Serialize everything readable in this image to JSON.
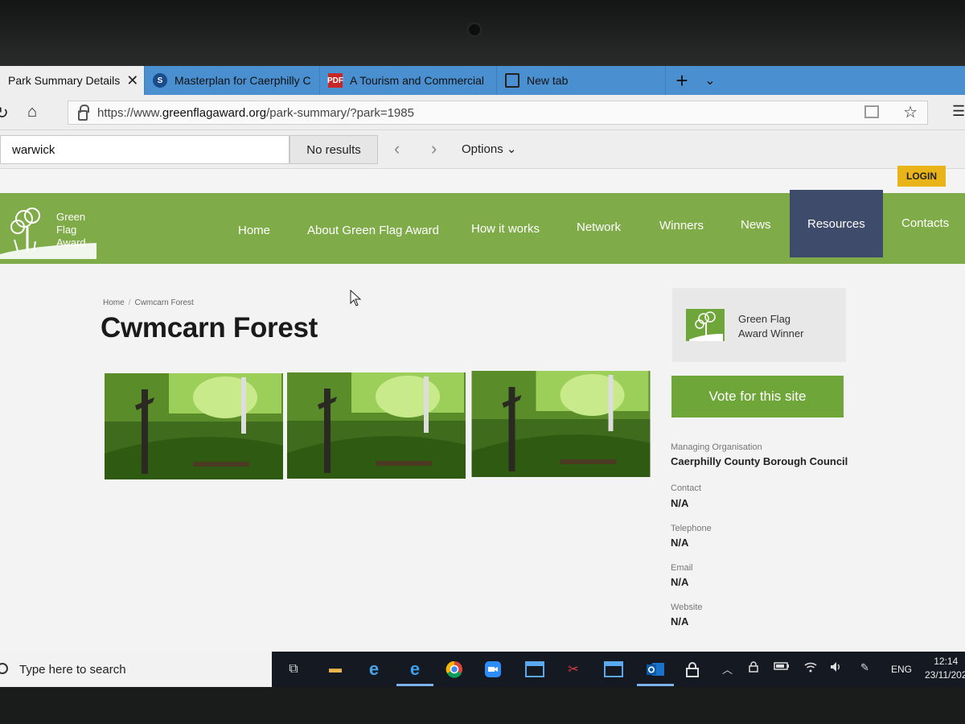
{
  "browser": {
    "tabs": [
      {
        "title": "Park Summary Details",
        "icon": "page-icon"
      },
      {
        "title": "Masterplan for Caerphilly C",
        "icon": "site-s-icon"
      },
      {
        "title": "A Tourism and Commercial",
        "icon": "pdf-icon"
      },
      {
        "title": "New tab",
        "icon": "new-tab-icon"
      }
    ],
    "url_prefix": "https://www.",
    "url_domain": "greenflagaward.org",
    "url_path": "/park-summary/?park=1985"
  },
  "find_bar": {
    "query": "warwick",
    "status": "No results",
    "options_label": "Options"
  },
  "site": {
    "login_label": "LOGIN",
    "logo_lines": [
      "Green",
      "Flag",
      "Award"
    ],
    "nav": [
      "Home",
      "About Green Flag Award",
      "How it works",
      "Network",
      "Winners",
      "News",
      "Resources",
      "Contacts"
    ]
  },
  "page": {
    "breadcrumb_home": "Home",
    "breadcrumb_current": "Cwmcarn Forest",
    "title": "Cwmcarn Forest",
    "award_line1": "Green Flag",
    "award_line2": "Award Winner",
    "vote_label": "Vote for this site",
    "info": [
      {
        "label": "Managing Organisation",
        "value": "Caerphilly County Borough Council"
      },
      {
        "label": "Contact",
        "value": "N/A"
      },
      {
        "label": "Telephone",
        "value": "N/A"
      },
      {
        "label": "Email",
        "value": "N/A"
      },
      {
        "label": "Website",
        "value": "N/A"
      }
    ]
  },
  "taskbar": {
    "search_placeholder": "Type here to search",
    "language": "ENG",
    "time": "12:14",
    "date": "23/11/202"
  },
  "colors": {
    "nav_green": "#7fac48",
    "resources_navy": "#3e4b6b",
    "vote_green": "#6fa63a",
    "login_yellow": "#e8b419",
    "browser_tab_blue": "#4a90d0"
  }
}
